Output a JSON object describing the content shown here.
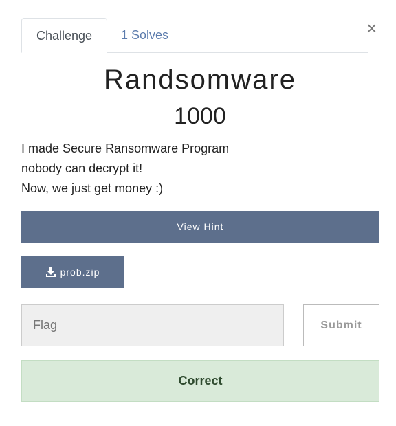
{
  "tabs": [
    {
      "label": "Challenge",
      "active": true
    },
    {
      "label": "1 Solves",
      "active": false
    }
  ],
  "close_symbol": "×",
  "challenge": {
    "title": "Randsomware",
    "points": "1000",
    "description_lines": [
      "I made Secure Ransomware Program",
      "nobody can decrypt it!",
      "Now, we just get money :)"
    ]
  },
  "hint_button": {
    "label": "View Hint"
  },
  "file_button": {
    "label": "prob.zip",
    "icon": "download-icon"
  },
  "flag_input": {
    "placeholder": "Flag",
    "value": ""
  },
  "submit_button": {
    "label": "Submit"
  },
  "result": {
    "text": "Correct"
  },
  "colors": {
    "primary_button": "#5d6f8c",
    "tab_link": "#5c7cad",
    "success_bg": "#d9ead9",
    "success_text": "#2e4a2e"
  }
}
